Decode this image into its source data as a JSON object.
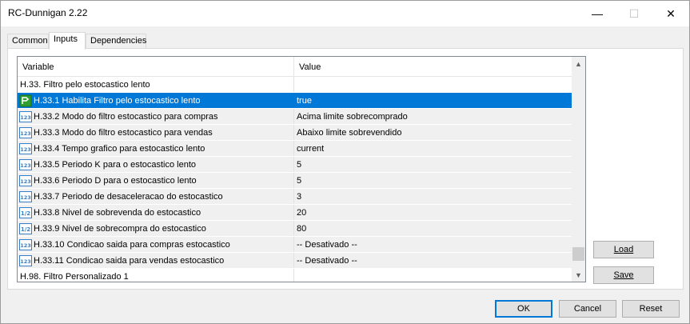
{
  "window": {
    "title": "RC-Dunnigan 2.22",
    "minimize_symbol": "—",
    "maximize_symbol": "☐",
    "close_symbol": "✕"
  },
  "tabs": [
    {
      "label": "Common",
      "active": false
    },
    {
      "label": "Inputs",
      "active": true
    },
    {
      "label": "Dependencies",
      "active": false
    }
  ],
  "grid": {
    "columns": {
      "variable": "Variable",
      "value": "Value"
    },
    "rows": [
      {
        "kind": "group",
        "variable": "H.33. Filtro pelo estocastico lento",
        "value": ""
      },
      {
        "kind": "param",
        "icon": "bool-icon",
        "variable": "H.33.1 Habilita Filtro pelo estocastico lento",
        "value": "true",
        "selected": true
      },
      {
        "kind": "param",
        "icon": "int-icon",
        "variable": "H.33.2 Modo do filtro estocastico para compras",
        "value": "Acima limite sobrecomprado"
      },
      {
        "kind": "param",
        "icon": "int-icon",
        "variable": "H.33.3 Modo do filtro estocastico para vendas",
        "value": "Abaixo limite sobrevendido"
      },
      {
        "kind": "param",
        "icon": "int-icon",
        "variable": "H.33.4 Tempo grafico para estocastico lento",
        "value": "current"
      },
      {
        "kind": "param",
        "icon": "int-icon",
        "variable": "H.33.5 Periodo K para o estocastico lento",
        "value": "5"
      },
      {
        "kind": "param",
        "icon": "int-icon",
        "variable": "H.33.6 Periodo D para o estocastico lento",
        "value": "5"
      },
      {
        "kind": "param",
        "icon": "int-icon",
        "variable": "H.33.7 Periodo de desaceleracao do estocastico",
        "value": "3"
      },
      {
        "kind": "param",
        "icon": "double-icon",
        "variable": "H.33.8 Nivel de sobrevenda do estocastico",
        "value": "20"
      },
      {
        "kind": "param",
        "icon": "double-icon",
        "variable": "H.33.9 Nivel de sobrecompra do estocastico",
        "value": "80"
      },
      {
        "kind": "param",
        "icon": "int-icon",
        "variable": "H.33.10 Condicao saida para compras estocastico",
        "value": "-- Desativado --"
      },
      {
        "kind": "param",
        "icon": "int-icon",
        "variable": "H.33.11 Condicao saida para vendas estocastico",
        "value": "-- Desativado --"
      },
      {
        "kind": "group",
        "variable": "H.98. Filtro Personalizado 1",
        "value": ""
      }
    ],
    "icon_glyphs": {
      "int": "123",
      "double": "1/2"
    }
  },
  "side_buttons": {
    "load": "Load",
    "save": "Save"
  },
  "buttons": {
    "ok": "OK",
    "cancel": "Cancel",
    "reset": "Reset"
  },
  "colors": {
    "selection": "#0078d7",
    "alt_row": "#f0f0f0",
    "bool_icon": "#2e9e2e",
    "int_icon": "#3a7fc4"
  }
}
